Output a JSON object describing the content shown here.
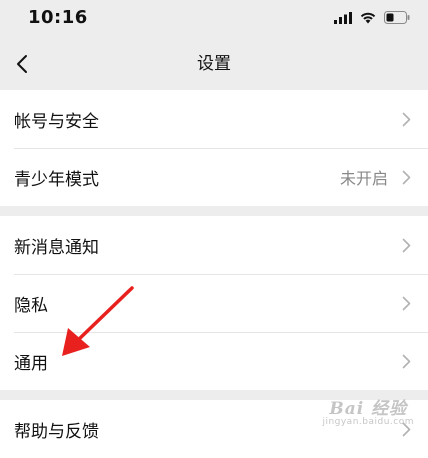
{
  "status_bar": {
    "time": "10:16",
    "icons": [
      "cellular-signal-icon",
      "wifi-icon",
      "battery-icon"
    ]
  },
  "nav": {
    "title": "设置",
    "back_icon": "chevron-left-icon"
  },
  "groups": [
    {
      "items": [
        {
          "label": "帐号与安全",
          "value": ""
        },
        {
          "label": "青少年模式",
          "value": "未开启"
        }
      ]
    },
    {
      "items": [
        {
          "label": "新消息通知",
          "value": ""
        },
        {
          "label": "隐私",
          "value": ""
        },
        {
          "label": "通用",
          "value": ""
        }
      ]
    },
    {
      "items": [
        {
          "label": "帮助与反馈",
          "value": ""
        }
      ]
    }
  ],
  "annotation": {
    "type": "red-arrow",
    "target": "通用",
    "color": "#e8211f"
  },
  "watermark": {
    "main": "Bai 经验",
    "sub": "jingyan.baidu.com"
  },
  "colors": {
    "background": "#ededed",
    "row_background": "#ffffff",
    "divider": "#e5e5e5",
    "chevron": "#b2b2b2",
    "secondary_text": "#888888"
  }
}
